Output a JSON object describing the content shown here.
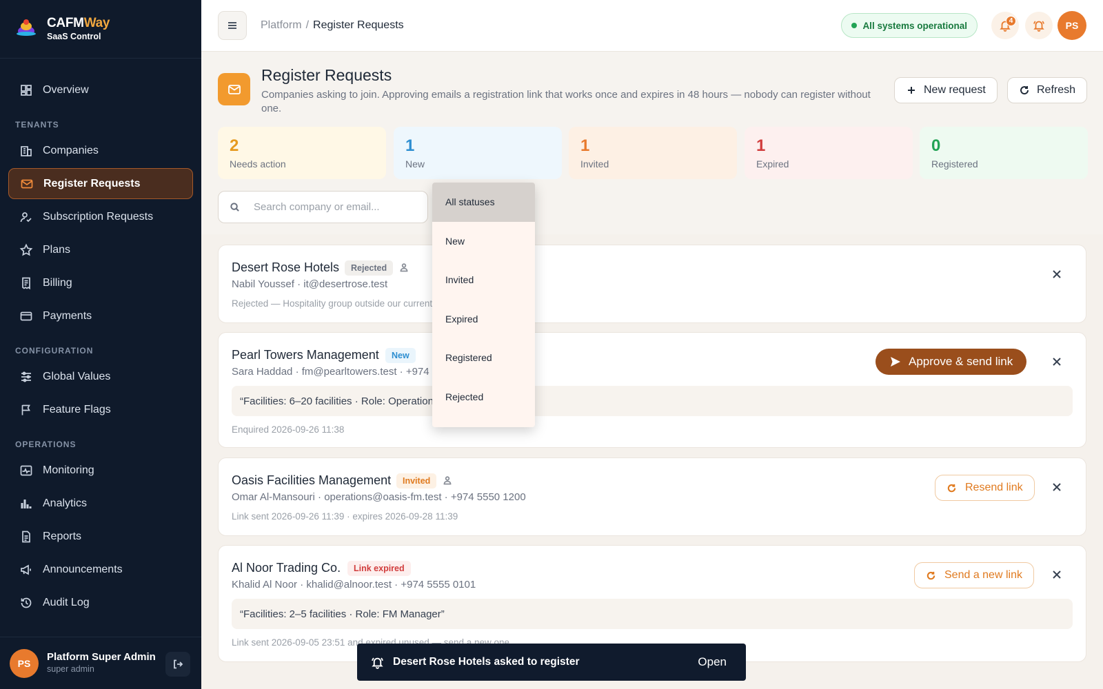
{
  "brand": {
    "name_a": "CAFM",
    "name_b": "Way",
    "subtitle": "SaaS Control"
  },
  "nav": {
    "overview": "Overview",
    "sections": {
      "tenants": "TENANTS",
      "configuration": "CONFIGURATION",
      "operations": "OPERATIONS"
    },
    "companies": "Companies",
    "register_requests": "Register Requests",
    "subscription_requests": "Subscription Requests",
    "plans": "Plans",
    "billing": "Billing",
    "payments": "Payments",
    "global_values": "Global Values",
    "feature_flags": "Feature Flags",
    "monitoring": "Monitoring",
    "analytics": "Analytics",
    "reports": "Reports",
    "announcements": "Announcements",
    "audit_log": "Audit Log"
  },
  "user": {
    "initials": "PS",
    "name": "Platform Super Admin",
    "role": "super admin"
  },
  "topbar": {
    "breadcrumb_root": "Platform",
    "breadcrumb_sep": "/",
    "breadcrumb_current": "Register Requests",
    "status": "All systems operational",
    "notif_count": "4"
  },
  "header": {
    "title": "Register Requests",
    "description": "Companies asking to join. Approving emails a registration link that works once and expires in 48 hours — nobody can register without one.",
    "new_request": "New request",
    "refresh": "Refresh"
  },
  "stats": [
    {
      "value": "2",
      "label": "Needs action",
      "color": "#e69a1f",
      "bg": "#fff8e6"
    },
    {
      "value": "1",
      "label": "New",
      "color": "#2f8fd1",
      "bg": "#eef7fd"
    },
    {
      "value": "1",
      "label": "Invited",
      "color": "#e87a2d",
      "bg": "#fdf0e4"
    },
    {
      "value": "1",
      "label": "Expired",
      "color": "#d13d3d",
      "bg": "#fdf0ef"
    },
    {
      "value": "0",
      "label": "Registered",
      "color": "#22a355",
      "bg": "#eefaf1"
    }
  ],
  "search": {
    "placeholder": "Search company or email..."
  },
  "status_filter": {
    "options": [
      "All statuses",
      "New",
      "Invited",
      "Expired",
      "Registered",
      "Rejected"
    ],
    "selected": "All statuses"
  },
  "requests": [
    {
      "company": "Desert Rose Hotels",
      "tag": "Rejected",
      "contact": "Nabil Youssef · it@desertrose.test",
      "meta": "Rejected — Hospitality group outside our current market"
    },
    {
      "company": "Pearl Towers Management",
      "tag": "New",
      "contact": "Sara Haddad · fm@pearltowers.test · +974 5550 3300",
      "quote": "“Facilities: 6–20 facilities · Role: Operations Director”",
      "meta": "Enquired 2026-09-26 11:38",
      "action": "Approve & send link"
    },
    {
      "company": "Oasis Facilities Management",
      "tag": "Invited",
      "contact": "Omar Al-Mansouri · operations@oasis-fm.test · +974 5550 1200",
      "meta": "Link sent 2026-09-26 11:39 · expires 2026-09-28 11:39",
      "action": "Resend link"
    },
    {
      "company": "Al Noor Trading Co.",
      "tag": "Link expired",
      "contact": "Khalid Al Noor · khalid@alnoor.test · +974 5555 0101",
      "quote": "“Facilities: 2–5 facilities · Role: FM Manager”",
      "meta": "Link sent 2026-09-05 23:51 and expired unused — send a new one",
      "action": "Send a new link"
    }
  ],
  "toast": {
    "message": "Desert Rose Hotels asked to register",
    "action": "Open"
  }
}
